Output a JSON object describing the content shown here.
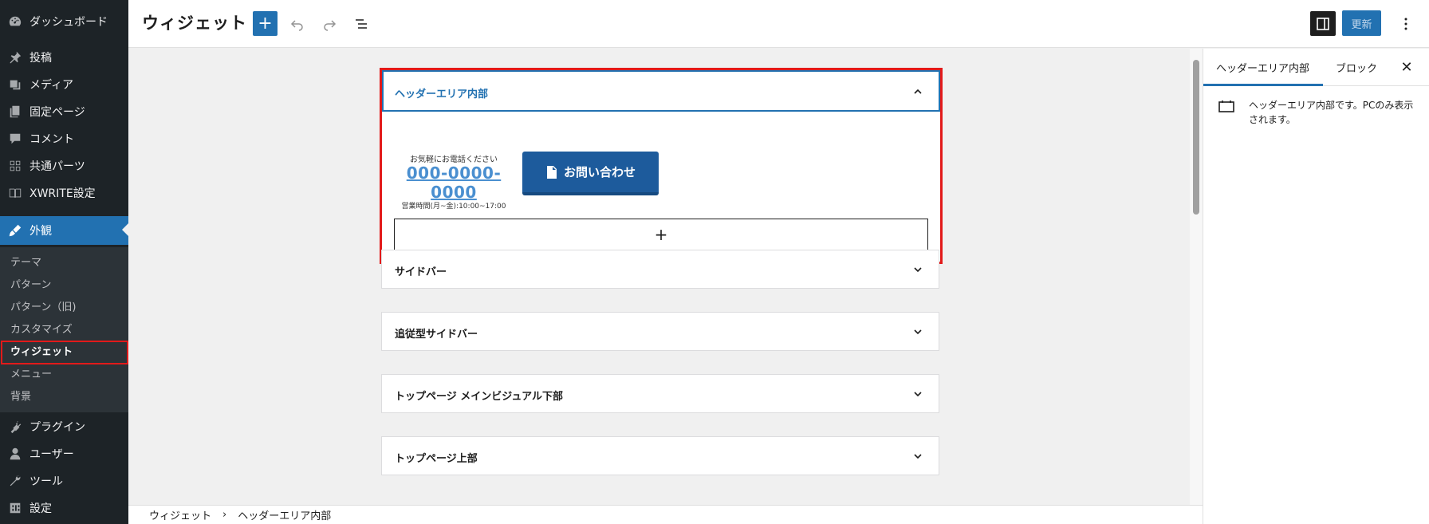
{
  "sidebar": {
    "items": [
      {
        "label": "ダッシュボード",
        "icon": "dashboard-icon"
      },
      {
        "label": "投稿",
        "icon": "pin-icon"
      },
      {
        "label": "メディア",
        "icon": "media-icon"
      },
      {
        "label": "固定ページ",
        "icon": "page-icon"
      },
      {
        "label": "コメント",
        "icon": "comment-icon"
      },
      {
        "label": "共通パーツ",
        "icon": "blocks-icon"
      },
      {
        "label": "XWRITE設定",
        "icon": "book-icon"
      },
      {
        "label": "外観",
        "icon": "brush-icon"
      },
      {
        "label": "プラグイン",
        "icon": "plugin-icon"
      },
      {
        "label": "ユーザー",
        "icon": "user-icon"
      },
      {
        "label": "ツール",
        "icon": "wrench-icon"
      },
      {
        "label": "設定",
        "icon": "settings-icon"
      }
    ],
    "submenu": [
      "テーマ",
      "パターン",
      "パターン（旧)",
      "カスタマイズ",
      "ウィジェット",
      "メニュー",
      "背景"
    ]
  },
  "header": {
    "title": "ウィジェット",
    "add_label": "+",
    "update_label": "更新"
  },
  "canvas": {
    "open_area": {
      "title": "ヘッダーエリア内部",
      "tel_lead": "お気軽にお電話ください",
      "tel_number": "000-0000-0000",
      "tel_hours": "営業時間(月~金):10:00~17:00",
      "contact_label": "お問い合わせ",
      "add_block_label": "+"
    },
    "areas": [
      "サイドバー",
      "追従型サイドバー",
      "トップページ メインビジュアル下部",
      "トップページ上部"
    ]
  },
  "panel": {
    "tab_area": "ヘッダーエリア内部",
    "tab_block": "ブロック",
    "close_label": "✕",
    "description": "ヘッダーエリア内部です。PCのみ表示されます。"
  },
  "footer": {
    "crumb_1": "ウィジェット",
    "separator": "›",
    "crumb_2": "ヘッダーエリア内部"
  },
  "colors": {
    "sidebar_bg": "#1d2327",
    "accent": "#2271b1",
    "highlight": "#e21a1a",
    "contact_button": "#1d5b9c"
  }
}
